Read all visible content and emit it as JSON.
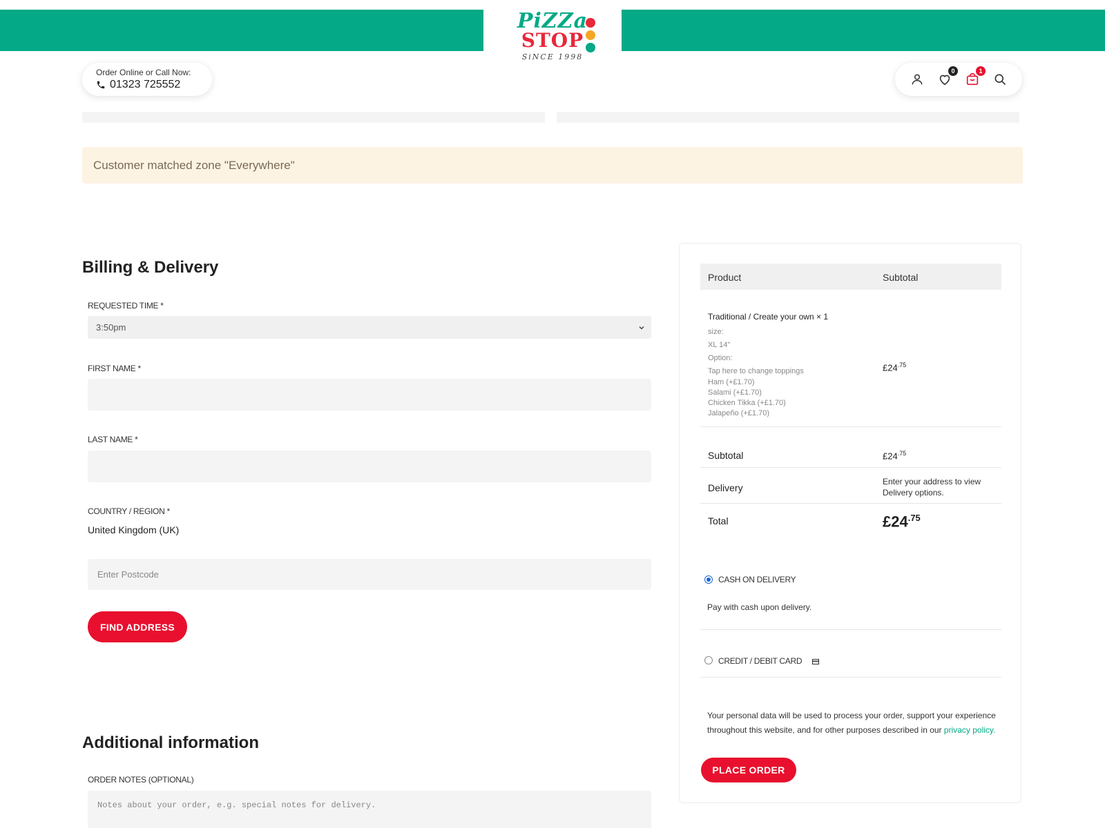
{
  "header": {
    "logo": {
      "line1": "PiZZa",
      "line2": "STOP",
      "since": "SiNCE 1998"
    },
    "call_label": "Order Online or Call Now:",
    "phone": "01323 725552",
    "wishlist_count": "0",
    "cart_count": "1"
  },
  "notice": {
    "text": "Customer matched zone \"Everywhere\""
  },
  "billing": {
    "title": "Billing & Delivery",
    "requested_time_label": "REQUESTED TIME *",
    "requested_time_value": "3:50pm",
    "first_name_label": "FIRST NAME *",
    "first_name_value": "",
    "last_name_label": "LAST NAME *",
    "last_name_value": "",
    "country_label": "COUNTRY / REGION *",
    "country_value": "United Kingdom (UK)",
    "postcode_placeholder": "Enter Postcode",
    "find_address_label": "FIND ADDRESS"
  },
  "additional": {
    "title": "Additional information",
    "notes_label": "ORDER NOTES (OPTIONAL)",
    "notes_placeholder": "Notes about your order, e.g. special notes for delivery."
  },
  "order": {
    "col_product": "Product",
    "col_subtotal": "Subtotal",
    "item": {
      "name": "Traditional / Create your own",
      "qty": "× 1",
      "meta": [
        "size:",
        "XL 14\"",
        "Option:",
        "Tap here to change toppings",
        "Ham (+£1.70)",
        "Salami (+£1.70)",
        "Chicken Tikka (+£1.70)",
        "Jalapeño (+£1.70)"
      ],
      "price_main": "£24",
      "price_frac": ".75"
    },
    "subtotal_label": "Subtotal",
    "subtotal_main": "£24",
    "subtotal_frac": ".75",
    "delivery_label": "Delivery",
    "delivery_note": "Enter your address to view Delivery options.",
    "total_label": "Total",
    "total_main": "£24",
    "total_frac": ".75"
  },
  "payment": {
    "cod_label": "CASH ON DELIVERY",
    "cod_desc": "Pay with cash upon delivery.",
    "card_label": "CREDIT / DEBIT CARD",
    "privacy_text": "Your personal data will be used to process your order, support your experience throughout this website, and for other purposes described in our",
    "privacy_link": "privacy policy.",
    "place_order_label": "PLACE ORDER"
  },
  "colors": {
    "brand_green": "#04a987",
    "brand_red": "#e8102e",
    "notice_bg": "#fdf3e3"
  }
}
